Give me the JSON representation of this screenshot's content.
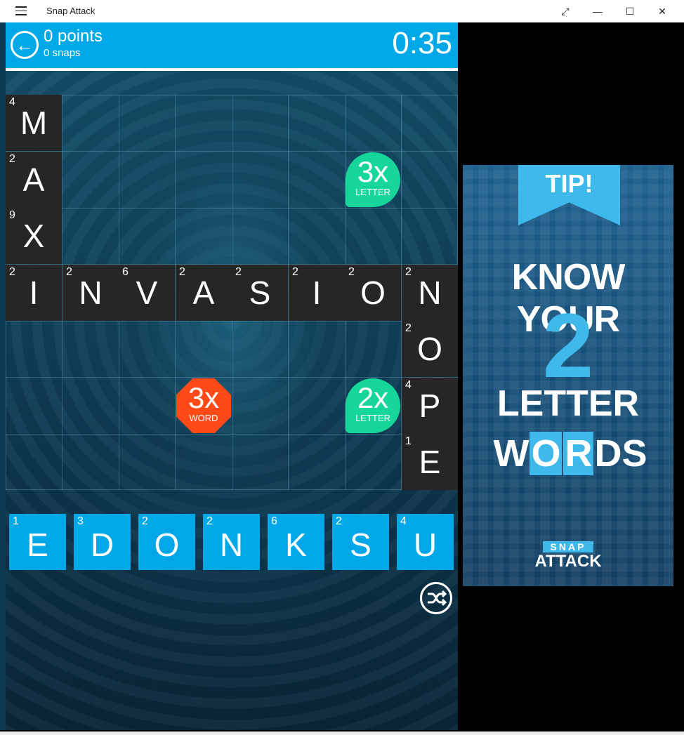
{
  "window": {
    "title": "Snap Attack",
    "menu_icon": "hamburger-icon",
    "controls": {
      "restore": "⤢",
      "minimize": "—",
      "maximize": "☐",
      "close": "✕"
    }
  },
  "header": {
    "back_icon": "back-arrow-icon",
    "back_glyph": "←",
    "points": "0 points",
    "snaps": "0 snaps",
    "timer": "0:35"
  },
  "board": {
    "tiles": [
      {
        "letter": "M",
        "score": "4"
      },
      {
        "letter": "A",
        "score": "2"
      },
      {
        "letter": "X",
        "score": "9"
      },
      {
        "letter": "I",
        "score": "2"
      },
      {
        "letter": "N",
        "score": "2"
      },
      {
        "letter": "V",
        "score": "6"
      },
      {
        "letter": "A",
        "score": "2"
      },
      {
        "letter": "S",
        "score": "2"
      },
      {
        "letter": "I",
        "score": "2"
      },
      {
        "letter": "O",
        "score": "2"
      },
      {
        "letter": "N",
        "score": "2"
      },
      {
        "letter": "O",
        "score": "2"
      },
      {
        "letter": "P",
        "score": "4"
      },
      {
        "letter": "E",
        "score": "1"
      }
    ],
    "bonuses": [
      {
        "value": "3x",
        "label": "LETTER",
        "color": "#16d69a"
      },
      {
        "value": "3x",
        "label": "WORD",
        "color": "#ff4a17"
      },
      {
        "value": "2x",
        "label": "LETTER",
        "color": "#16d69a"
      }
    ]
  },
  "rack": {
    "tiles": [
      {
        "letter": "E",
        "score": "1"
      },
      {
        "letter": "D",
        "score": "3"
      },
      {
        "letter": "O",
        "score": "2"
      },
      {
        "letter": "N",
        "score": "2"
      },
      {
        "letter": "K",
        "score": "6"
      },
      {
        "letter": "S",
        "score": "2"
      },
      {
        "letter": "U",
        "score": "4"
      }
    ],
    "shuffle_icon": "shuffle-icon"
  },
  "ad": {
    "tip": "TIP!",
    "line1": "KNOW YOUR",
    "line2": "2",
    "line3": "LETTER",
    "line4_parts": [
      "W",
      "O",
      "R",
      "D",
      "S"
    ],
    "logo_top": "SNAP",
    "logo_bottom": "ATTACK"
  },
  "colors": {
    "header": "#00a8e8",
    "tile": "#262626",
    "rack_tile": "#00a8e8",
    "accent": "#3fb9ec"
  }
}
